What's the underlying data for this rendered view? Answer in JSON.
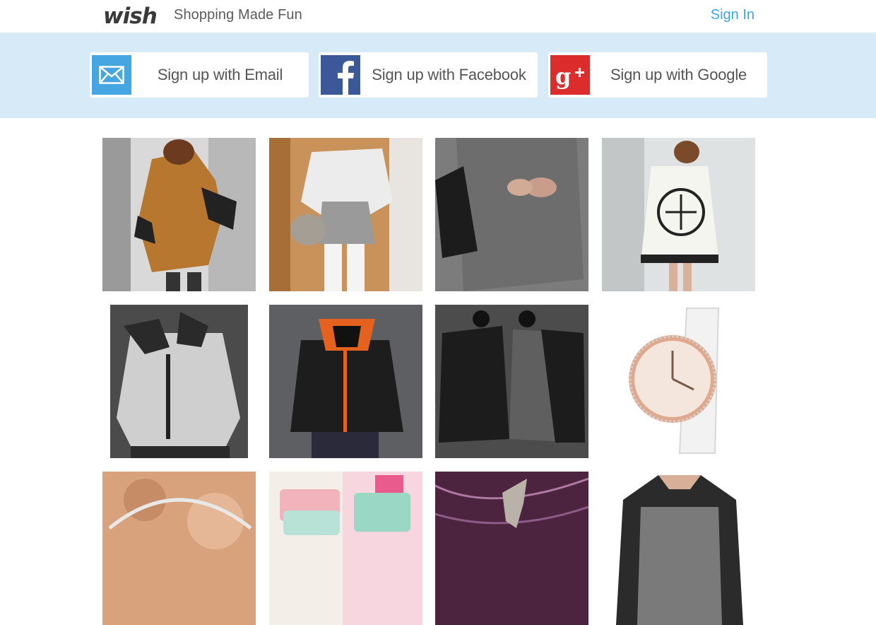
{
  "header": {
    "logo_text": "wish",
    "tagline": "Shopping Made Fun",
    "signin_label": "Sign In"
  },
  "signup": {
    "email_label": "Sign up with Email",
    "facebook_label": "Sign up with Facebook",
    "google_label": "Sign up with Google",
    "email_icon": "envelope-icon",
    "facebook_icon": "facebook-icon",
    "google_icon": "google-plus-icon"
  },
  "colors": {
    "brand_blue": "#3da6e2",
    "band": "#d6eaf8",
    "facebook": "#3b5998",
    "google": "#dd2c2c",
    "email": "#46a6e1"
  },
  "products": [
    {
      "kind": "orange-batwing-top"
    },
    {
      "kind": "lace-cape-blouse"
    },
    {
      "kind": "gray-oversized-sweater"
    },
    {
      "kind": "white-printed-poncho"
    },
    {
      "kind": "gray-asymmetric-hoodie"
    },
    {
      "kind": "black-orange-hoodie"
    },
    {
      "kind": "black-gray-blazers"
    },
    {
      "kind": "rose-gold-watch"
    },
    {
      "kind": "silver-bangle"
    },
    {
      "kind": "pastel-wallets"
    },
    {
      "kind": "dragon-pendant"
    },
    {
      "kind": "gray-raglan-sweater"
    }
  ]
}
